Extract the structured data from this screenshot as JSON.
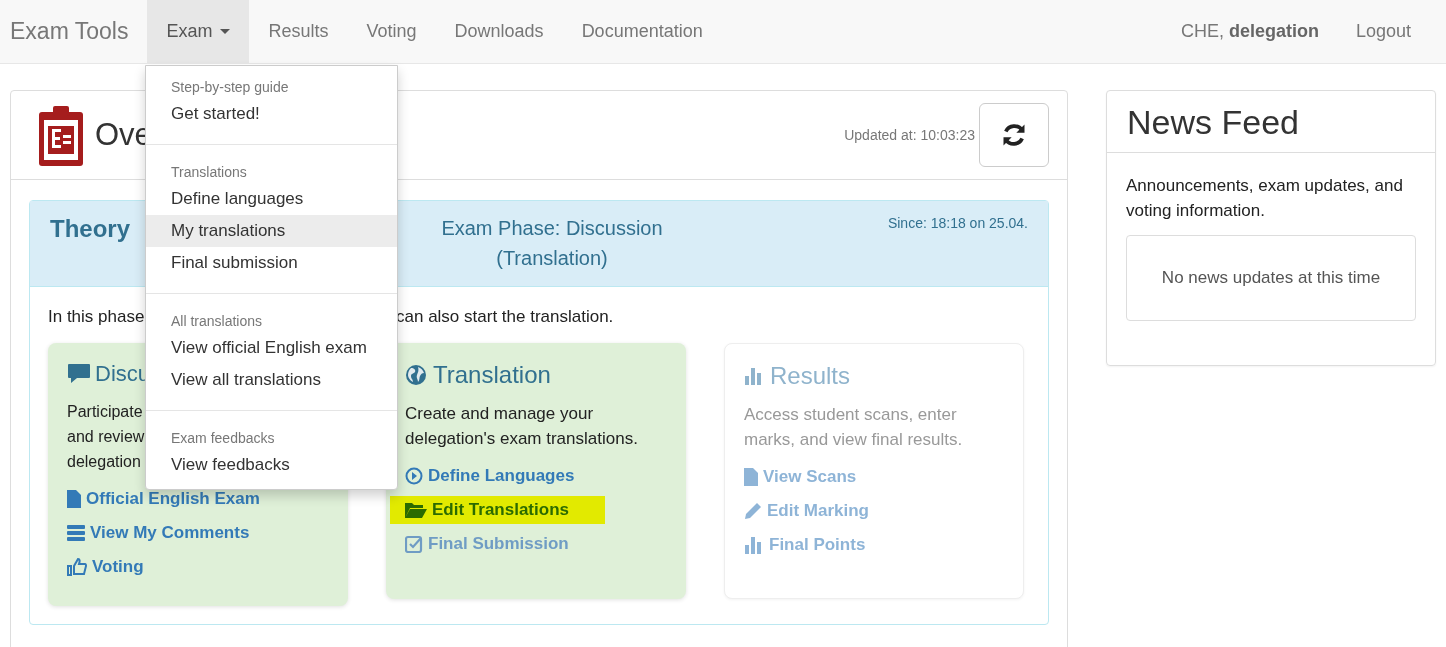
{
  "navbar": {
    "brand": "Exam Tools",
    "items": [
      {
        "label": "Exam",
        "selected": true,
        "dropdown": true
      },
      {
        "label": "Results",
        "selected": false,
        "dropdown": false
      },
      {
        "label": "Voting",
        "selected": false,
        "dropdown": false
      },
      {
        "label": "Downloads",
        "selected": false,
        "dropdown": false
      },
      {
        "label": "Documentation",
        "selected": false,
        "dropdown": false
      }
    ],
    "user": "CHE, **delegation**",
    "logout": "Logout"
  },
  "exam_menu": {
    "sections": [
      {
        "header": "Step-by-step guide",
        "items": [
          {
            "label": "Get started!",
            "selected": false
          }
        ]
      },
      {
        "header": "Translations",
        "items": [
          {
            "label": "Define languages",
            "selected": false
          },
          {
            "label": "My translations",
            "selected": true
          },
          {
            "label": "Final submission",
            "selected": false
          }
        ]
      },
      {
        "header": "All translations",
        "items": [
          {
            "label": "View official English exam",
            "selected": false
          },
          {
            "label": "View all translations",
            "selected": false
          }
        ]
      },
      {
        "header": "Exam feedbacks",
        "items": [
          {
            "label": "View feedbacks",
            "selected": false
          }
        ]
      }
    ]
  },
  "overview": {
    "title": "Ove",
    "updated": "Updated at: 10:03:23",
    "phase": {
      "exam": "Theory",
      "phase": "Exam Phase: Discussion",
      "phase_detail": "(Translation)",
      "since": "Since: 18:18 on 25.04."
    },
    "intro_left": "In this phase",
    "intro_right": "can also start the translation.",
    "cards": [
      {
        "title": "Discu",
        "disabled": false,
        "lines": [
          "Participate",
          "and review",
          "delegation"
        ],
        "links": [
          {
            "label": "Official English Exam",
            "disabled": false,
            "highlighted": false
          },
          {
            "label": "View My Comments",
            "disabled": false,
            "highlighted": false
          },
          {
            "label": "Voting",
            "disabled": false,
            "highlighted": false
          }
        ]
      },
      {
        "title": "Translation",
        "disabled": false,
        "lines": [
          "Create and manage your",
          "delegation's exam translations."
        ],
        "links": [
          {
            "label": "Define Languages",
            "disabled": false,
            "highlighted": false
          },
          {
            "label": "Edit Translations",
            "disabled": false,
            "highlighted": true
          },
          {
            "label": "Final Submission",
            "disabled": true,
            "highlighted": false
          }
        ]
      },
      {
        "title": "Results",
        "disabled": true,
        "lines": [
          "Access student scans, enter",
          "marks, and view final results."
        ],
        "links": [
          {
            "label": "View Scans",
            "disabled": false,
            "highlighted": false
          },
          {
            "label": "Edit Marking",
            "disabled": false,
            "highlighted": false
          },
          {
            "label": "Final Points",
            "disabled": false,
            "highlighted": false
          }
        ]
      }
    ]
  },
  "news": {
    "title": "News Feed",
    "description": "Announcements, exam updates, and voting information.",
    "empty": "No news updates at this time"
  }
}
